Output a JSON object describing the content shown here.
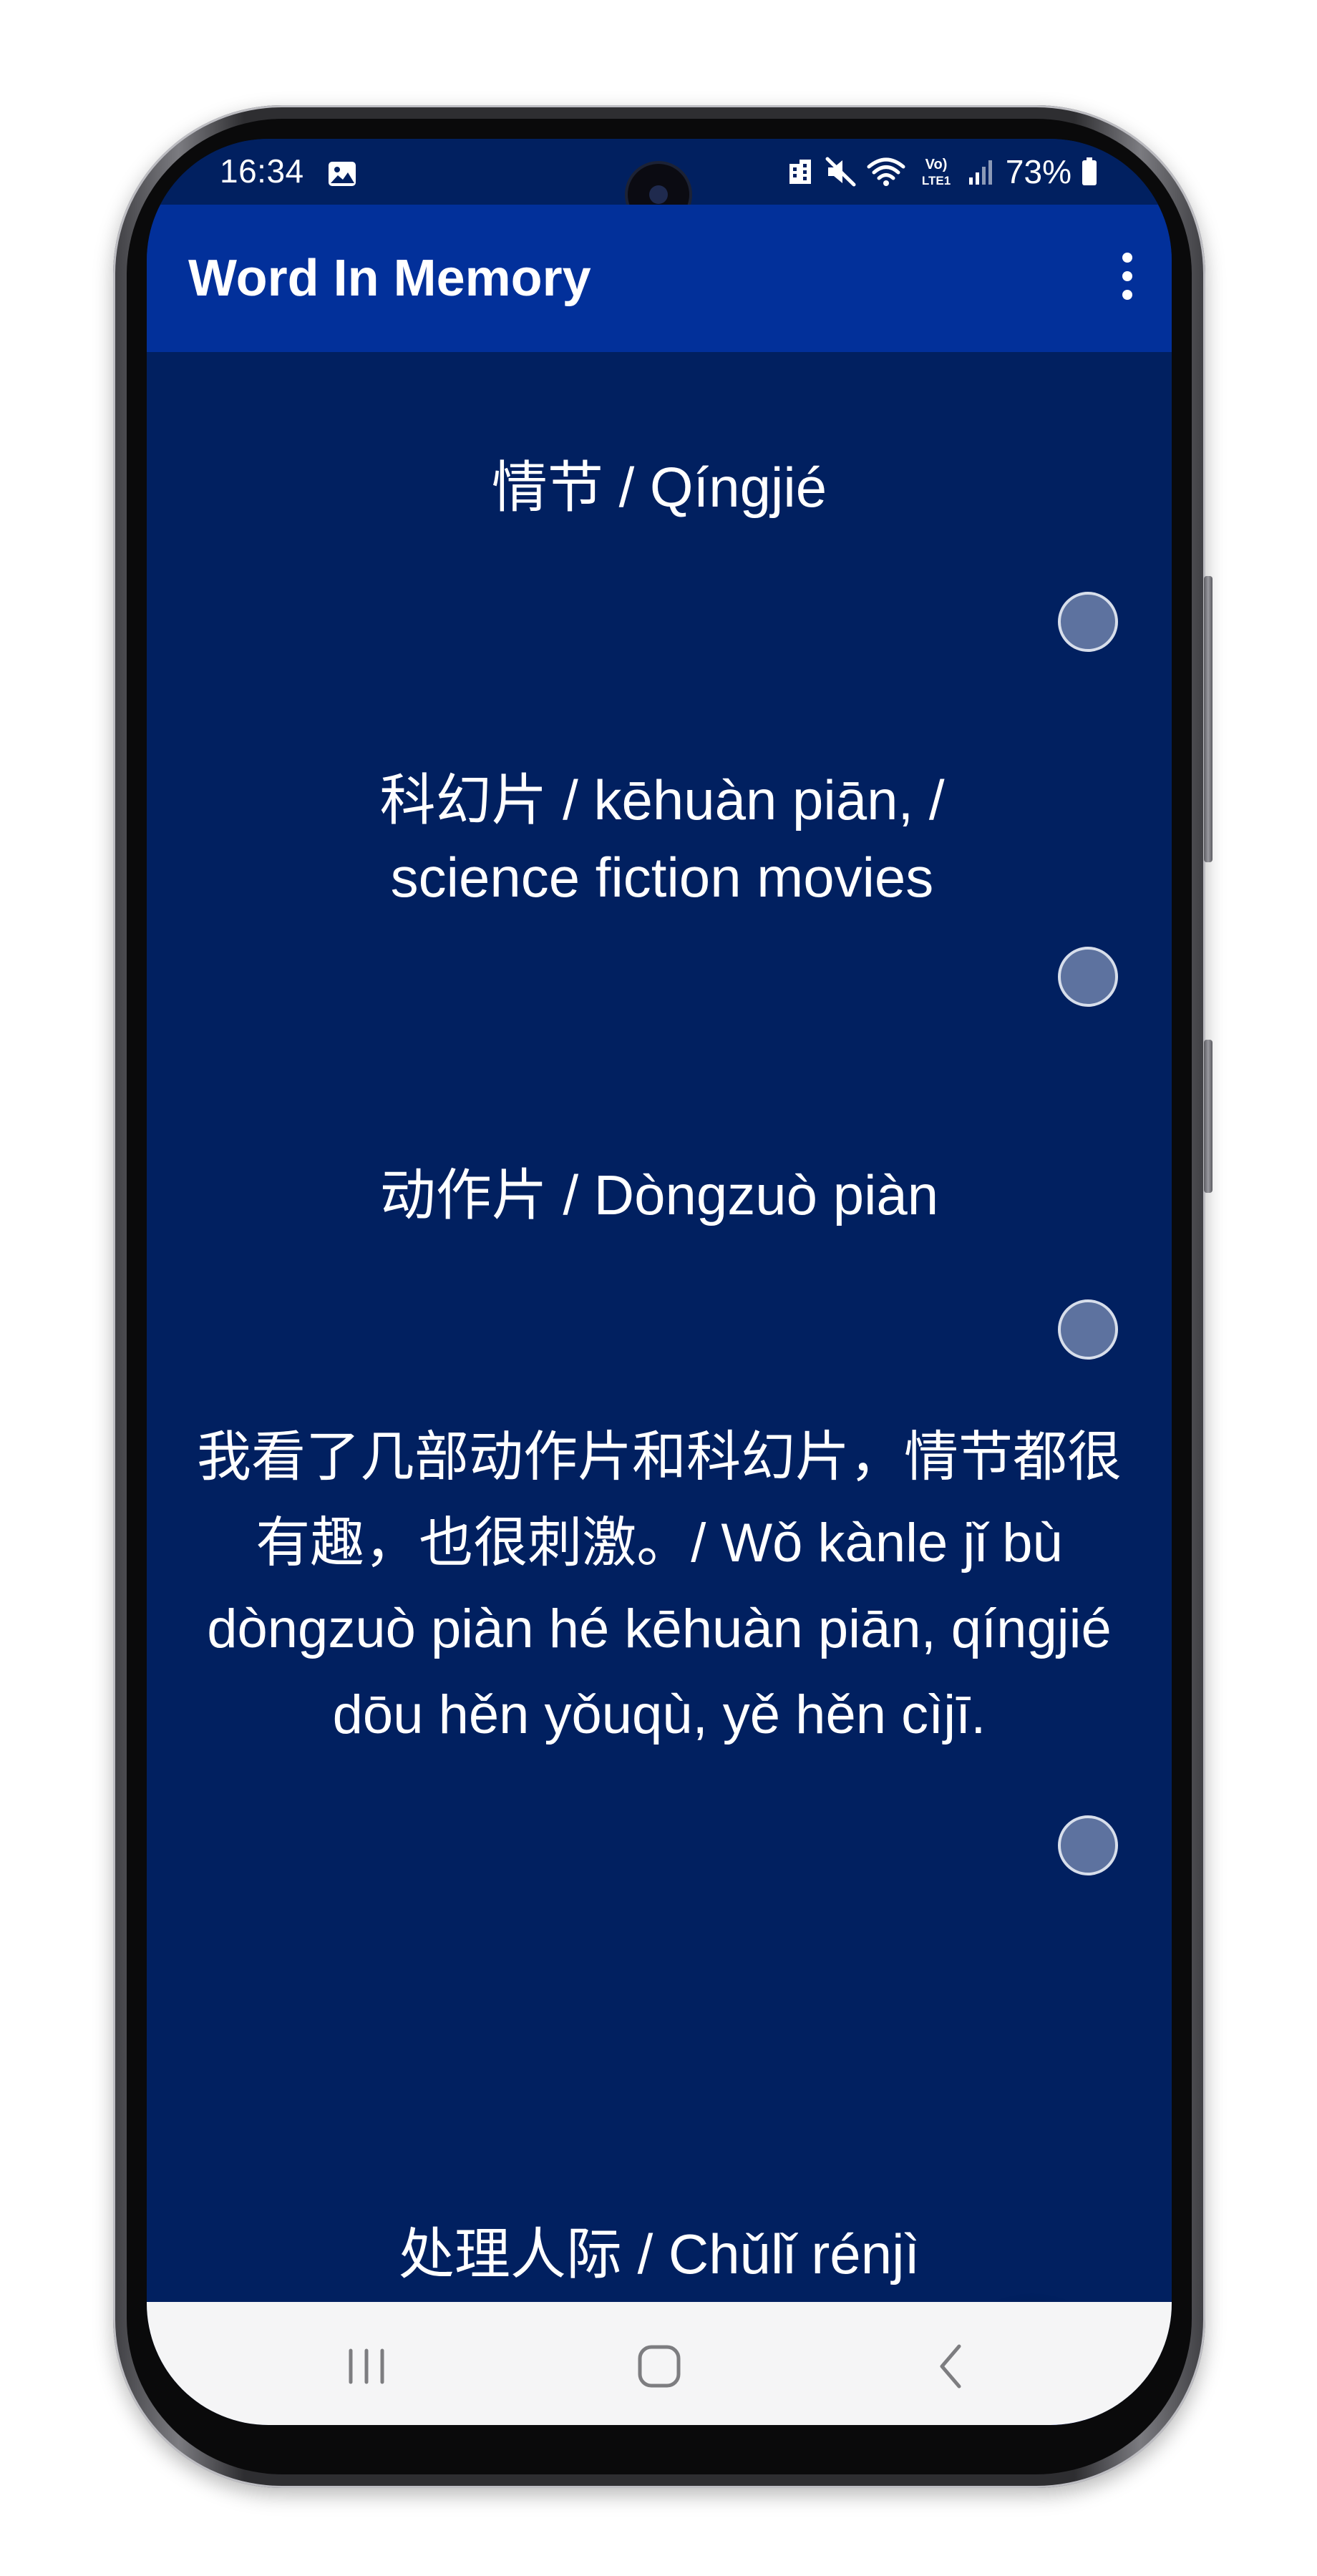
{
  "statusbar": {
    "time": "16:34",
    "icons": [
      "gallery-icon",
      "do-not-disturb-icon",
      "mute-icon",
      "wifi-icon",
      "volte-icon",
      "signal-icon",
      "battery-icon"
    ],
    "volte_label": "Vo) LTE1",
    "battery": "73%"
  },
  "appbar": {
    "title": "Word In Memory",
    "menu_icon": "more-vert-icon"
  },
  "words": [
    {
      "text": "情节 / Qíngjié"
    },
    {
      "text": "科幻片 / kēhuàn piān, / science fiction movies"
    },
    {
      "text": "动作片 / Dòngzuò piàn"
    },
    {
      "text": "我看了几部动作片和科幻片，情节都很有趣，也很刺激。/ Wǒ kànle jǐ bù dòngzuò piàn hé kēhuàn piān, qíngjié dōu hěn yǒuqù, yě hěn cìjī."
    },
    {
      "text": "处理人际 / Chǔlǐ rénjì"
    }
  ],
  "fab": {
    "icon": "add-icon"
  },
  "navbar": {
    "icons": [
      "recents-icon",
      "home-icon",
      "back-icon"
    ]
  },
  "colors": {
    "background": "#012060",
    "appbar": "#02309a",
    "fab": "#0026f2",
    "radio": "#5d729f",
    "navbar": "#f5f5f6"
  }
}
